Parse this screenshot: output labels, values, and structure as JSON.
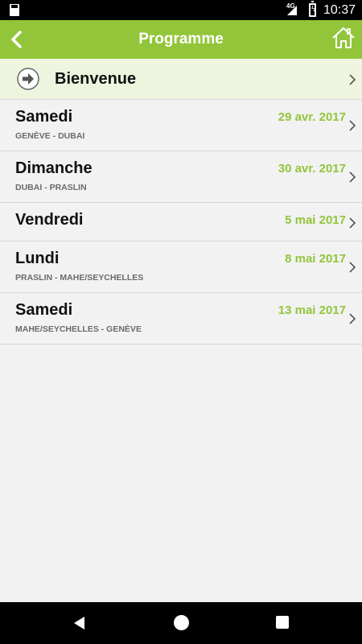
{
  "status_bar": {
    "network": "4G",
    "time": "10:37"
  },
  "app_bar": {
    "title": "Programme"
  },
  "welcome": {
    "label": "Bienvenue"
  },
  "items": [
    {
      "day": "Samedi",
      "date": "29 avr. 2017",
      "route": "GENÈVE - DUBAI"
    },
    {
      "day": "Dimanche",
      "date": "30 avr. 2017",
      "route": "DUBAI - PRASLIN"
    },
    {
      "day": "Vendredi",
      "date": "5 mai 2017",
      "route": ""
    },
    {
      "day": "Lundi",
      "date": "8 mai 2017",
      "route": "PRASLIN - MAHE/SEYCHELLES"
    },
    {
      "day": "Samedi",
      "date": "13 mai 2017",
      "route": "MAHE/SEYCHELLES - GENÈVE"
    }
  ],
  "colors": {
    "accent": "#92c53a",
    "welcome_bg": "#eef5df",
    "background": "#f2f2f2"
  }
}
